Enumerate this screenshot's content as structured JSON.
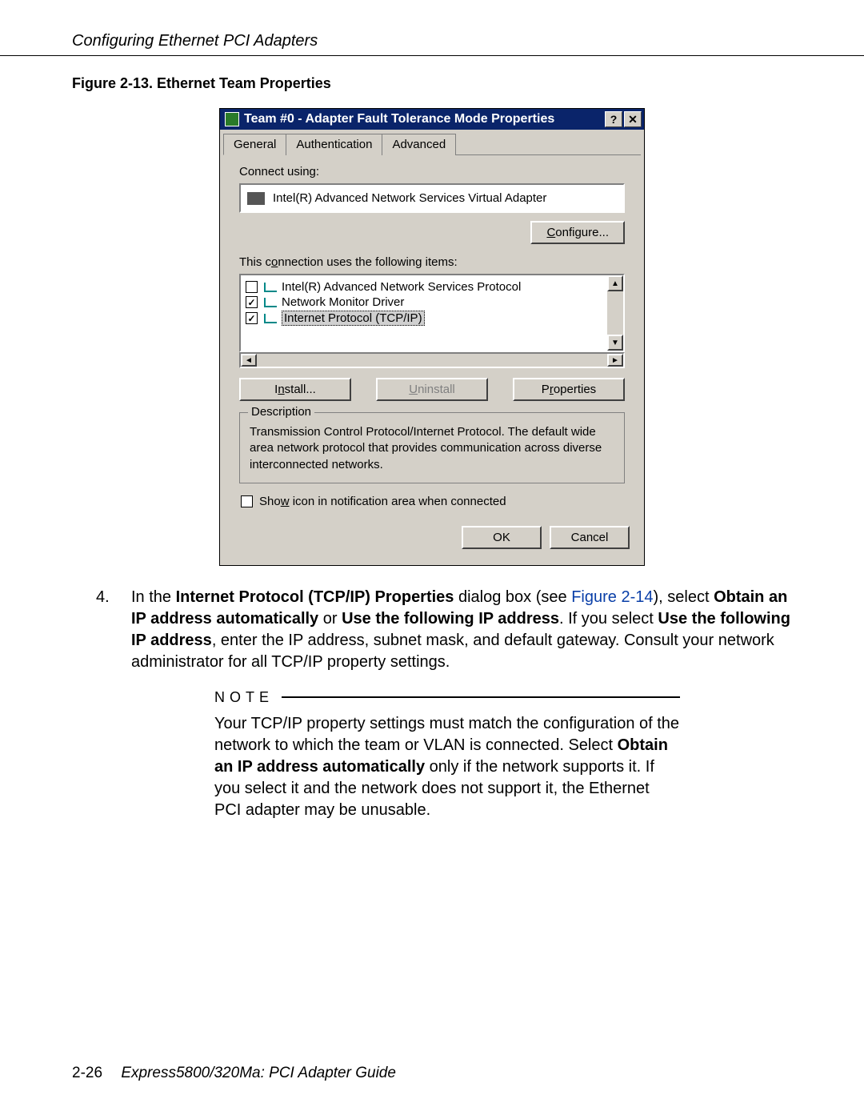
{
  "header": {
    "running_head": "Configuring Ethernet PCI Adapters"
  },
  "figure": {
    "caption": "Figure 2-13. Ethernet Team Properties"
  },
  "dialog": {
    "title": "Team #0 - Adapter Fault Tolerance Mode Properties",
    "help_btn": "?",
    "close_btn": "✕",
    "tabs": {
      "general": "General",
      "auth": "Authentication",
      "adv": "Advanced"
    },
    "connect_label": "Connect using:",
    "adapter_name": "Intel(R) Advanced Network Services Virtual Adapter",
    "configure_btn": "Configure...",
    "items_label": "This connection uses the following items:",
    "items": [
      {
        "checked": false,
        "label": "Intel(R) Advanced Network Services Protocol"
      },
      {
        "checked": true,
        "label": "Network Monitor Driver"
      },
      {
        "checked": true,
        "label": "Internet Protocol (TCP/IP)",
        "selected": true
      }
    ],
    "install_btn": "Install...",
    "uninstall_btn": "Uninstall",
    "properties_btn": "Properties",
    "desc_title": "Description",
    "desc_body": "Transmission Control Protocol/Internet Protocol. The default wide area network protocol that provides communication across diverse interconnected networks.",
    "showicon_label": "Show icon in notification area when connected",
    "ok_btn": "OK",
    "cancel_btn": "Cancel"
  },
  "step4": {
    "num": "4.",
    "pre": "In the ",
    "bold1": "Internet Protocol (TCP/IP) Properties",
    "mid1": " dialog box (see ",
    "ref": "Figure 2-14",
    "mid2": "), select ",
    "bold2": "Obtain an IP address automatically",
    "or": " or ",
    "bold3": "Use the following IP address",
    "mid3": ". If you select ",
    "bold4": "Use the following IP address",
    "tail": ", enter the IP address, subnet mask, and default gateway. Consult your network administrator for all TCP/IP property settings."
  },
  "note": {
    "heading": "NOTE",
    "p1a": "Your TCP/IP property settings must match the configuration of the network to which the team or VLAN is connected. Select ",
    "p1b": "Obtain an IP address automatically",
    "p1c": " only if the network supports it. If you select it and the network does not support it, the Ethernet PCI adapter may be unusable."
  },
  "footer": {
    "pagenum": "2-26",
    "booktitle": "Express5800/320Ma: PCI Adapter Guide"
  }
}
